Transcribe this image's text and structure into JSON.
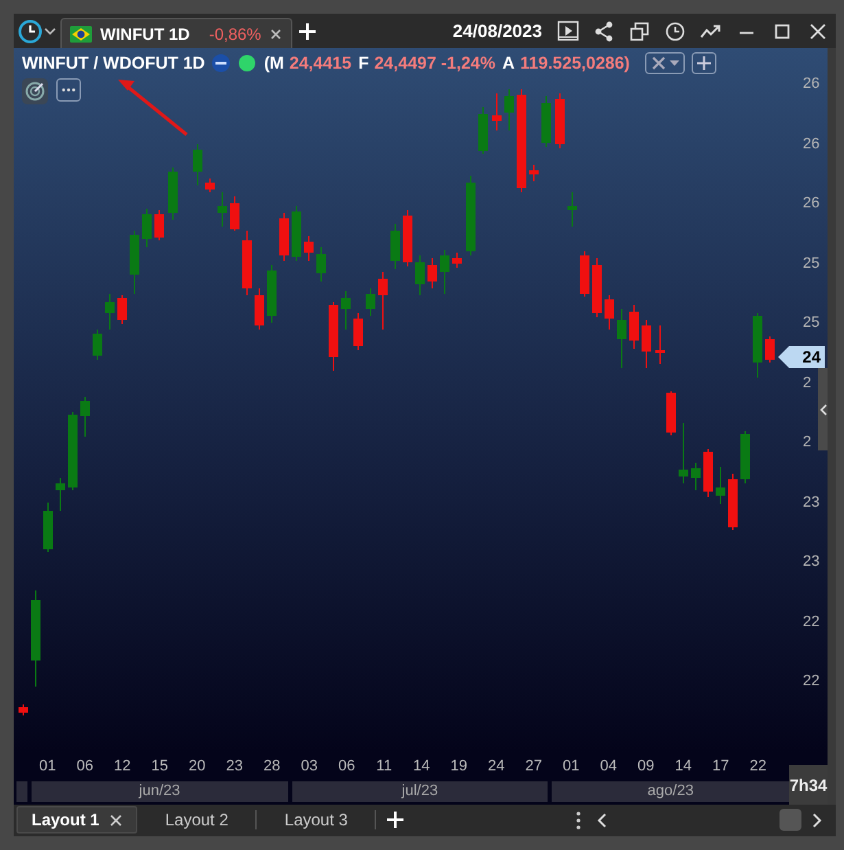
{
  "toolbar": {
    "tabs": [
      {
        "label": "WINFUT 1D",
        "change": "-0,86%",
        "selected": true
      }
    ],
    "date": "24/08/2023"
  },
  "chart": {
    "title": "WINFUT / WDOFUT 1D",
    "connected": true,
    "quotes": [
      {
        "label": "(M",
        "value": "24,4415"
      },
      {
        "label": "F",
        "value": "24,4497 -1,24%"
      },
      {
        "label": "A",
        "value": "119.525,0286)"
      }
    ],
    "price_axis": [
      "26",
      "26",
      "26",
      "25",
      "25",
      "2",
      "2",
      "23",
      "23",
      "22",
      "22"
    ],
    "last_price": "24",
    "date_labels": [
      "01",
      "06",
      "12",
      "15",
      "20",
      "23",
      "28",
      "03",
      "06",
      "11",
      "14",
      "19",
      "24",
      "27",
      "01",
      "04",
      "09",
      "14",
      "17",
      "22"
    ],
    "months": [
      "jun/23",
      "jul/23",
      "ago/23"
    ],
    "time_left": "7h34"
  },
  "layouts": [
    {
      "label": "Layout 1",
      "selected": true
    },
    {
      "label": "Layout 2",
      "selected": false
    },
    {
      "label": "Layout 3",
      "selected": false
    }
  ]
}
